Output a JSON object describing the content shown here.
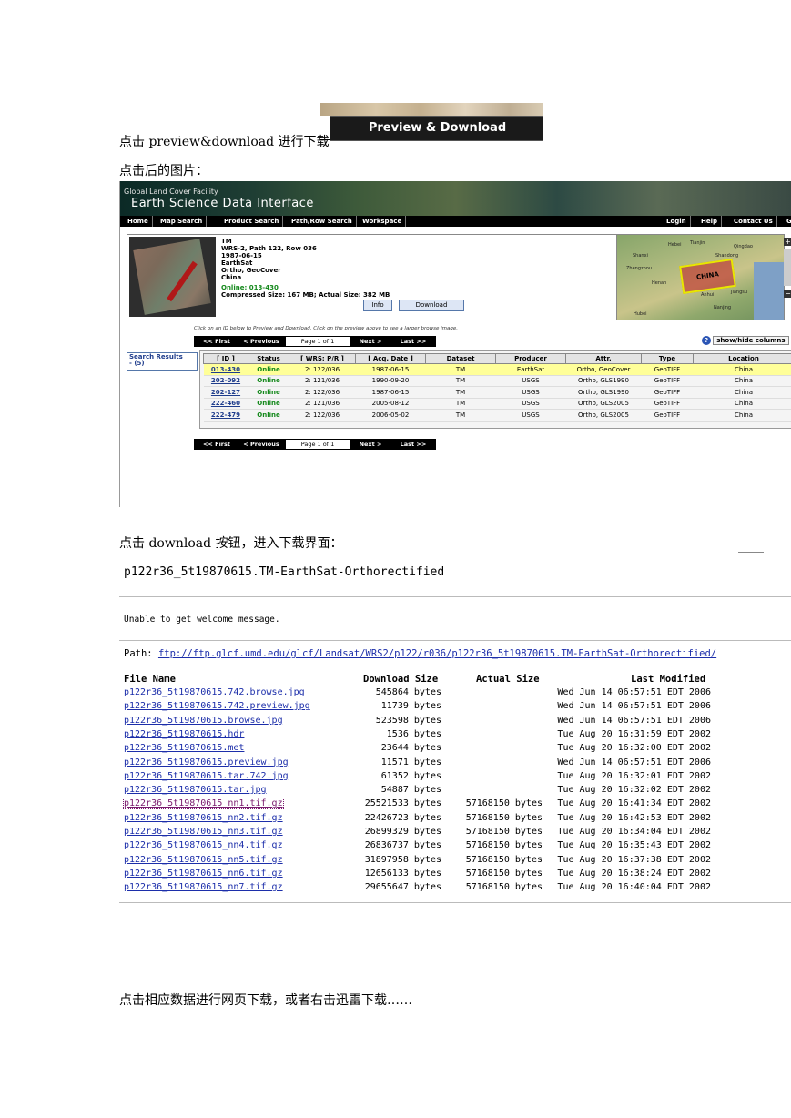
{
  "paragraphs": {
    "p1": "点击 preview&download 进行下载",
    "p2": "点击后的图片：",
    "p3": "点击 download 按钮，进入下载界面：",
    "p4": "点击相应数据进行网页下载，或者右击迅雷下载……"
  },
  "preview_button": {
    "label": "Preview & Download"
  },
  "glcf": {
    "brand_line1": "Global Land Cover Facility",
    "brand_line2": "Earth Science Data Interface",
    "nav_left": [
      "Home",
      "Map Search",
      "Product Search",
      "Path/Row Search",
      "Workspace"
    ],
    "nav_right": [
      "Login",
      "Help",
      "Contact Us",
      "G"
    ],
    "scene": {
      "dataset": "TM",
      "wrs": "WRS-2, Path 122, Row 036",
      "date": "1987-06-15",
      "producer": "EarthSat",
      "attr": "Ortho, GeoCover",
      "location": "China",
      "online": "Online: 013-430",
      "sizes": "Compressed Size: 167 MB; Actual Size: 382 MB",
      "info_btn": "Info",
      "download_btn": "Download"
    },
    "map": {
      "box_label": "CHINA",
      "labels": [
        "Hebei",
        "Tianjin",
        "Qingdao",
        "Shanxi",
        "Shandong",
        "Zhengzhou",
        "Jiangsu",
        "Anhui",
        "Hubei",
        "Nanjing",
        "Henan"
      ]
    },
    "zoom": [
      "+",
      "−"
    ],
    "hint": "Click on an ID below to Preview and Download. Click on the preview above to see a larger browse image.",
    "pager": {
      "first": "<< First",
      "prev": "< Previous",
      "page": "Page 1 of 1",
      "next": "Next >",
      "last": "Last >>"
    },
    "help_icon": "?",
    "show_hide": "show/hide columns",
    "search_results_label": "Search Results",
    "search_results_count": "- (5)",
    "columns": [
      "[ ID ]",
      "Status",
      "[ WRS: P/R ]",
      "[ Acq. Date ]",
      "Dataset",
      "Producer",
      "Attr.",
      "Type",
      "Location"
    ],
    "rows": [
      [
        "013-430",
        "Online",
        "2: 122/036",
        "1987-06-15",
        "TM",
        "EarthSat",
        "Ortho, GeoCover",
        "GeoTIFF",
        "China"
      ],
      [
        "202-092",
        "Online",
        "2: 121/036",
        "1990-09-20",
        "TM",
        "USGS",
        "Ortho, GLS1990",
        "GeoTIFF",
        "China"
      ],
      [
        "202-127",
        "Online",
        "2: 122/036",
        "1987-06-15",
        "TM",
        "USGS",
        "Ortho, GLS1990",
        "GeoTIFF",
        "China"
      ],
      [
        "222-460",
        "Online",
        "2: 121/036",
        "2005-08-12",
        "TM",
        "USGS",
        "Ortho, GLS2005",
        "GeoTIFF",
        "China"
      ],
      [
        "222-479",
        "Online",
        "2: 122/036",
        "2006-05-02",
        "TM",
        "USGS",
        "Ortho, GLS2005",
        "GeoTIFF",
        "China"
      ]
    ]
  },
  "ftp": {
    "title": "p122r36_5t19870615.TM-EarthSat-Orthorectified",
    "welcome": "Unable to get welcome message.",
    "path_label": "Path: ",
    "path_url": "ftp://ftp.glcf.umd.edu/glcf/Landsat/WRS2/p122/r036/p122r36_5t19870615.TM-EarthSat-Orthorectified/",
    "headers": {
      "name": "File Name",
      "download": "Download Size",
      "actual": "Actual Size",
      "modified": "Last Modified"
    },
    "files": [
      {
        "name": "p122r36_5t19870615.742.browse.jpg",
        "dl": "545864 bytes",
        "ac": "",
        "lm": "Wed Jun 14 06:57:51 EDT 2006"
      },
      {
        "name": "p122r36_5t19870615.742.preview.jpg",
        "dl": "11739 bytes",
        "ac": "",
        "lm": "Wed Jun 14 06:57:51 EDT 2006"
      },
      {
        "name": "p122r36_5t19870615.browse.jpg",
        "dl": "523598 bytes",
        "ac": "",
        "lm": "Wed Jun 14 06:57:51 EDT 2006"
      },
      {
        "name": "p122r36_5t19870615.hdr",
        "dl": "1536 bytes",
        "ac": "",
        "lm": "Tue Aug 20 16:31:59 EDT 2002"
      },
      {
        "name": "p122r36_5t19870615.met",
        "dl": "23644 bytes",
        "ac": "",
        "lm": "Tue Aug 20 16:32:00 EDT 2002"
      },
      {
        "name": "p122r36_5t19870615.preview.jpg",
        "dl": "11571 bytes",
        "ac": "",
        "lm": "Wed Jun 14 06:57:51 EDT 2006"
      },
      {
        "name": "p122r36_5t19870615.tar.742.jpg",
        "dl": "61352 bytes",
        "ac": "",
        "lm": "Tue Aug 20 16:32:01 EDT 2002"
      },
      {
        "name": "p122r36_5t19870615.tar.jpg",
        "dl": "54887 bytes",
        "ac": "",
        "lm": "Tue Aug 20 16:32:02 EDT 2002"
      },
      {
        "name": "p122r36_5t19870615_nn1.tif.gz",
        "dl": "25521533 bytes",
        "ac": "57168150 bytes",
        "lm": "Tue Aug 20 16:41:34 EDT 2002"
      },
      {
        "name": "p122r36_5t19870615_nn2.tif.gz",
        "dl": "22426723 bytes",
        "ac": "57168150 bytes",
        "lm": "Tue Aug 20 16:42:53 EDT 2002"
      },
      {
        "name": "p122r36_5t19870615_nn3.tif.gz",
        "dl": "26899329 bytes",
        "ac": "57168150 bytes",
        "lm": "Tue Aug 20 16:34:04 EDT 2002"
      },
      {
        "name": "p122r36_5t19870615_nn4.tif.gz",
        "dl": "26836737 bytes",
        "ac": "57168150 bytes",
        "lm": "Tue Aug 20 16:35:43 EDT 2002"
      },
      {
        "name": "p122r36_5t19870615_nn5.tif.gz",
        "dl": "31897958 bytes",
        "ac": "57168150 bytes",
        "lm": "Tue Aug 20 16:37:38 EDT 2002"
      },
      {
        "name": "p122r36_5t19870615_nn6.tif.gz",
        "dl": "12656133 bytes",
        "ac": "57168150 bytes",
        "lm": "Tue Aug 20 16:38:24 EDT 2002"
      },
      {
        "name": "p122r36_5t19870615_nn7.tif.gz",
        "dl": "29655647 bytes",
        "ac": "57168150 bytes",
        "lm": "Tue Aug 20 16:40:04 EDT 2002"
      }
    ]
  }
}
